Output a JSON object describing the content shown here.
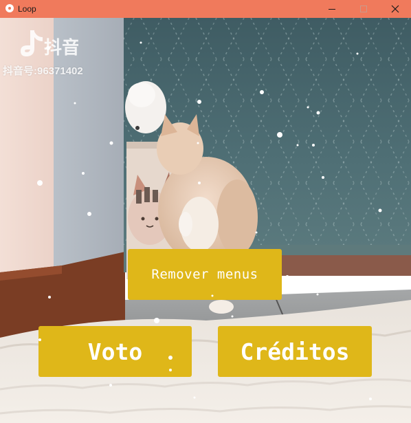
{
  "window": {
    "title": "Loop",
    "icon": "app-circle-icon",
    "controls": {
      "minimize_icon": "minimize-icon",
      "maximize_icon": "maximize-icon",
      "close_icon": "close-icon"
    },
    "title_bar_color": "#f07a5c"
  },
  "video": {
    "watermark_logo": "douyin-logo",
    "watermark_text": "抖音",
    "watermark_id": "抖音号:96371402"
  },
  "menu": {
    "remove_menus_label": "Remover menus",
    "vote_label": "Voto",
    "credits_label": "Créditos",
    "button_color": "#dfb719",
    "text_color": "#ffffff"
  }
}
